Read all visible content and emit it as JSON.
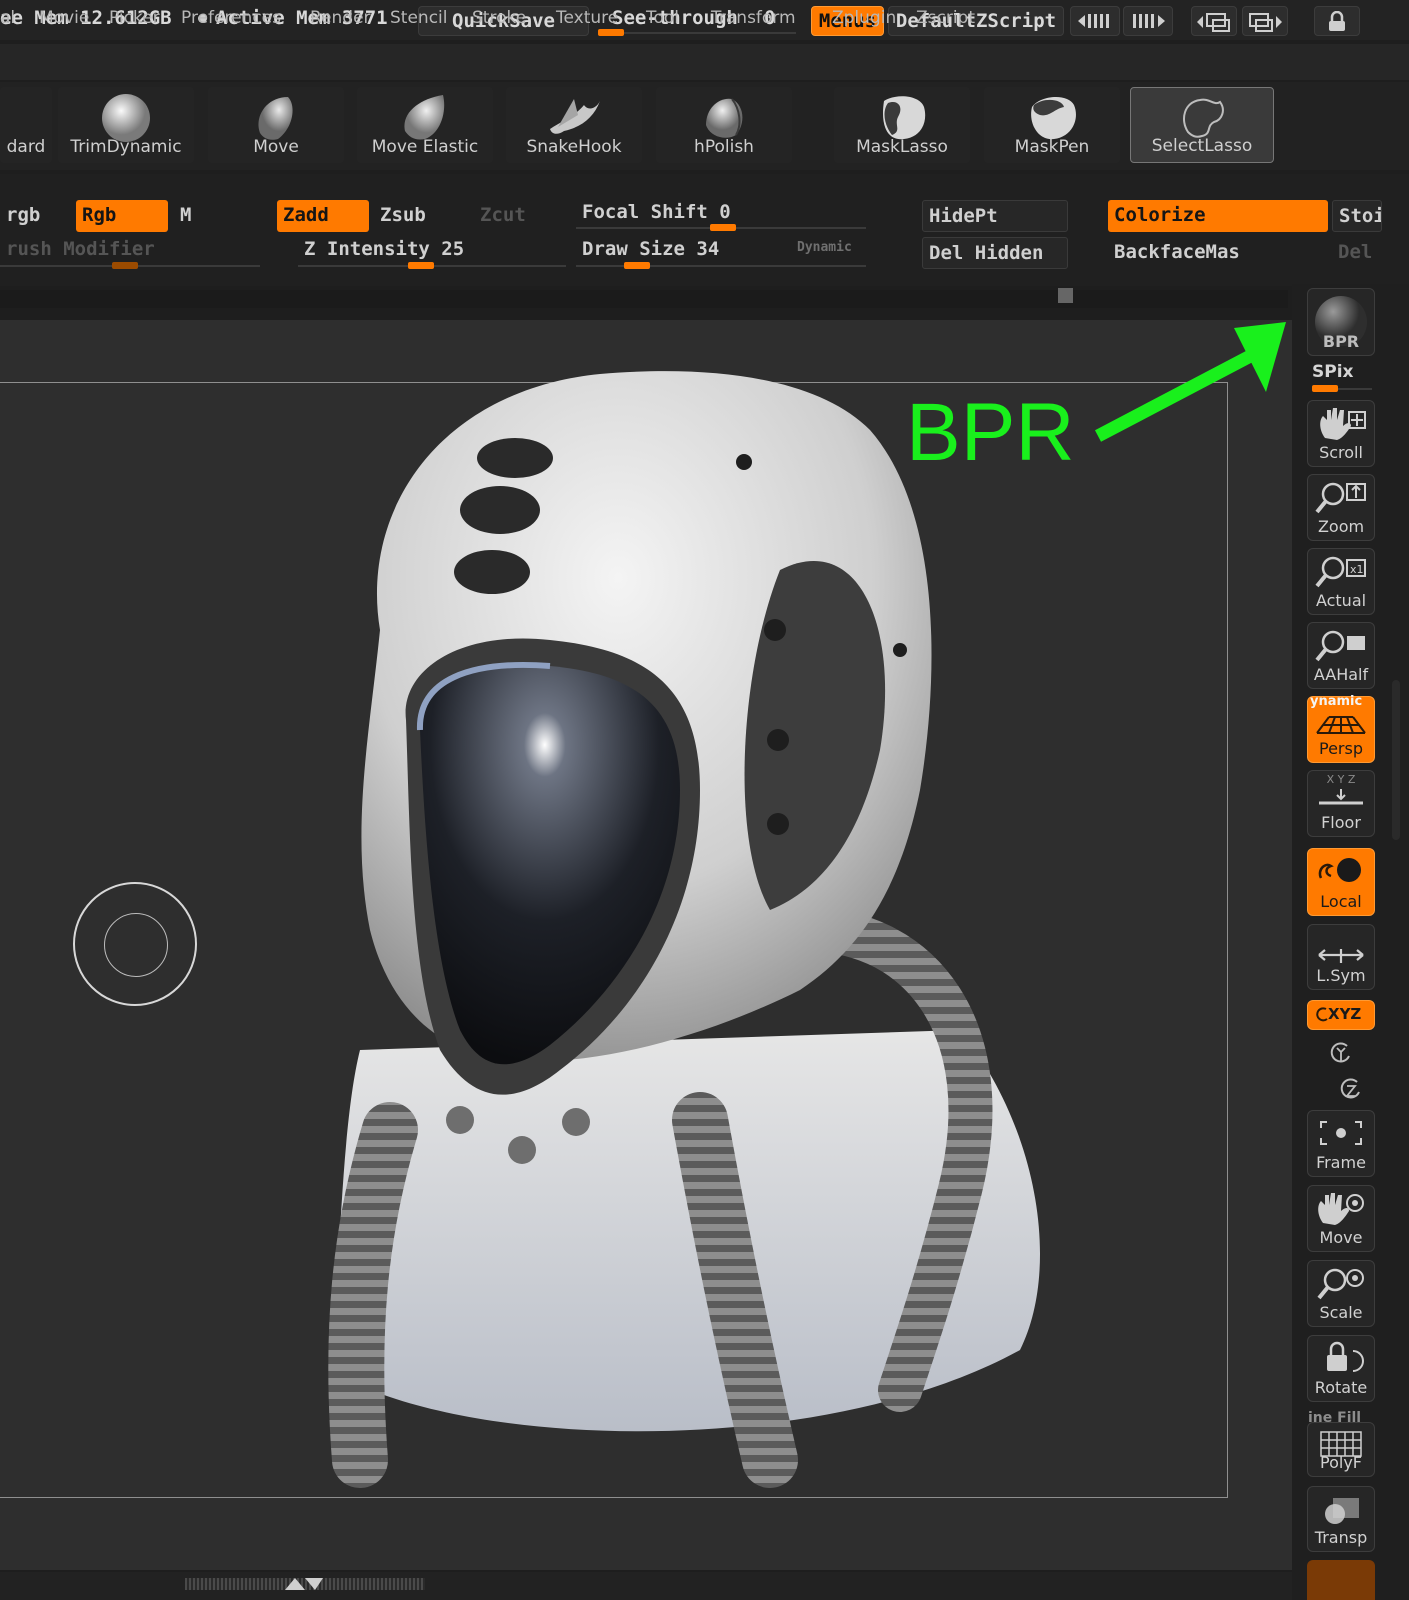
{
  "top_bar": {
    "free_mem": "ee Mem 12.612GB",
    "active_mem": "Active Mem 3771",
    "quicksave": "QuickSave",
    "see_through_label": "See-through",
    "see_through_value": "0",
    "menus": "Menus",
    "default_zscript": "DefaultZScript"
  },
  "menu_bar": [
    "al",
    "Movie",
    "Picker",
    "Preferences",
    "Render",
    "Stencil",
    "Stroke",
    "Texture",
    "Tool",
    "Transform",
    "Zplugin",
    "Zscript"
  ],
  "brushes": [
    "dard",
    "TrimDynamic",
    "Move",
    "Move Elastic",
    "SnakeHook",
    "hPolish",
    "MaskLasso",
    "MaskPen",
    "SelectLasso"
  ],
  "params": {
    "mrgb": "rgb",
    "rgb": "Rgb",
    "m": "M",
    "zadd": "Zadd",
    "zsub": "Zsub",
    "zcut": "Zcut",
    "brush_modifier": "rush Modifier",
    "z_intensity": "Z Intensity 25",
    "focal_shift": "Focal Shift 0",
    "draw_size": "Draw Size 34",
    "dynamic": "Dynamic",
    "hidept": "HidePt",
    "del_hidden": "Del Hidden",
    "colorize": "Colorize",
    "backface": "BackfaceMas",
    "stor": "Stoi",
    "del": "Del"
  },
  "right_shelf": {
    "bpr": "BPR",
    "spix": "SPix",
    "scroll": "Scroll",
    "zoom": "Zoom",
    "actual": "Actual",
    "aahalf": "AAHalf",
    "dynamic": "ynamic",
    "persp": "Persp",
    "xyz_small": "X Y Z",
    "floor": "Floor",
    "local": "Local",
    "lsym": "L.Sym",
    "xyz": "XYZ",
    "frame": "Frame",
    "move": "Move",
    "scale": "Scale",
    "rotate": "Rotate",
    "line_fill": "ine Fill",
    "polyf": "PolyF",
    "transp": "Transp"
  },
  "annotation": {
    "text": "BPR",
    "color": "#19f01c"
  },
  "colors": {
    "accent": "#ff7a00",
    "panel": "#222222",
    "canvas": "#2e2e2e"
  }
}
